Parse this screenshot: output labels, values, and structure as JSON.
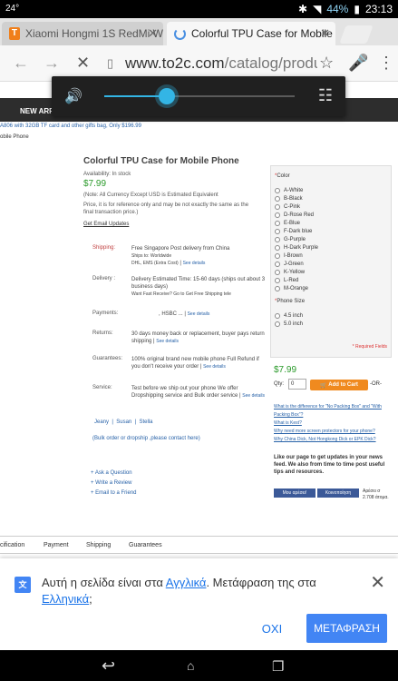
{
  "status": {
    "left_text": "24°",
    "battery": "44%",
    "time": "23:13"
  },
  "tabs": [
    {
      "label": "Xiaomi Hongmi 1S RedMi W"
    },
    {
      "label": "Colorful TPU Case for Mobile"
    }
  ],
  "toolbar": {
    "url_host": "www.to2c.com",
    "url_path": "/catalog/product/vie"
  },
  "volume": {
    "level": 0.33
  },
  "site": {
    "nav_label": "NEW ARRI",
    "promo": "A806 with 32GB TF card and other gifts bag, Only $196.99",
    "breadcrumb": "obile Phone"
  },
  "product": {
    "title": "Colorful TPU Case for Mobile Phone",
    "availability": "Availability: In stock",
    "price": "$7.99",
    "note1": "(Note: All Currency Except USD is Estimated Equivalent",
    "note2": "Price, it is for reference only and may be not exactly the same as the final transaction price.)",
    "email_updates": "Get Email Updates",
    "shipping_label": "Shipping:",
    "shipping_value": "Free Singapore Post delivery from China",
    "shipping_sub": "Ships to: Worldwide",
    "shipping_sub2": "DHL, EMS (Extra Cost)",
    "see_details": "See details",
    "delivery_label": "Delivery :",
    "delivery_value": "Delivery Estimated Time: 15-60 days (ships out about 3 business days)",
    "delivery_sub": "Want Fast Receive? Go to Get Free Shipping tele",
    "payments_label": "Payments:",
    "payments_value": ", HSBC ...",
    "returns_label": "Returns:",
    "returns_value": "30 days money back or replacement, buyer pays return shipping",
    "guarantees_label": "Guarantees:",
    "guarantees_value": "100% original brand new mobile phone Full Refund if you don't receive your order",
    "service_label": "Service:",
    "service_value": "Test before we ship out your phone We offer Dropshipping service and Bulk order service",
    "staff": [
      "Jeany",
      "Susan",
      "Stella"
    ],
    "bulk": "(Bulk order or dropship ,please contact here)",
    "links": [
      "+ Ask a Question",
      "+ Write a Review",
      "+ Email to a Friend"
    ]
  },
  "color_panel": {
    "title": "Color",
    "colors": [
      "A-White",
      "B-Black",
      "C-Pink",
      "D-Rose Red",
      "E-Blue",
      "F-Dark blue",
      "G-Purple",
      "H-Dark Purple",
      "I-Brown",
      "J-Green",
      "K-Yellow",
      "L-Red",
      "M-Orange"
    ],
    "size_title": "Phone Size",
    "sizes": [
      "4.5 inch",
      "5.0 inch"
    ],
    "required": "* Required Fields"
  },
  "cart": {
    "price": "$7.99",
    "qty_label": "Qty:",
    "qty_value": "0",
    "add_label": "Add to Cart",
    "or_label": "-OR-",
    "links": [
      "What is the difference for \"No Packing Box\" and \"With Packing Box\"?",
      "What is Kest?",
      "Why need more screen protectors for your phone?",
      "Why China Dick, Not Hongkong Dick or EPK Dick?"
    ],
    "fb_text": "Like our page to get updates in your news feed. We also from time to time post useful tips and resources.",
    "fb_button": "Μου αρέσει!",
    "share_button": "Κοινοποίηση",
    "fb_count": "Αρέσει σ 2.708 άτομα."
  },
  "product_tabs": [
    "cification",
    "Payment",
    "Shipping",
    "Guarantees"
  ],
  "translate": {
    "msg_before": "Αυτή η σελίδα είναι στα ",
    "lang_from": "Αγγλικά",
    "msg_mid": ". Μετάφραση της στα ",
    "lang_to": "Ελληνικά",
    "msg_end": ";",
    "no_label": "ΟΧΙ",
    "yes_label": "ΜΕΤΑΦΡΑΣΗ"
  }
}
